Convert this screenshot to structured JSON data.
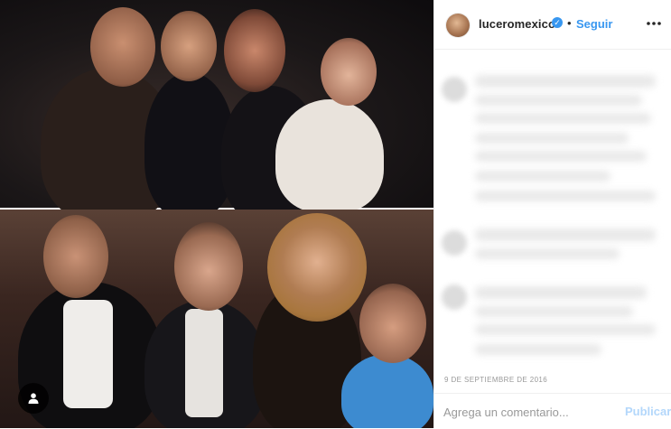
{
  "post": {
    "username": "luceromexico",
    "verified_glyph": "✓",
    "separator": "•",
    "follow_label": "Seguir",
    "date": "9 DE SEPTIEMBRE DE 2016"
  },
  "comment_box": {
    "placeholder": "Agrega un comentario...",
    "publish_label": "Publicar"
  },
  "icons": {
    "tag": "person-tag-icon",
    "more": "more-options-icon",
    "verified": "verified-badge-icon"
  },
  "colors": {
    "accent": "#3897f0",
    "publish_disabled": "#b3d7fb",
    "muted_text": "#999999",
    "divider": "#efefef"
  }
}
